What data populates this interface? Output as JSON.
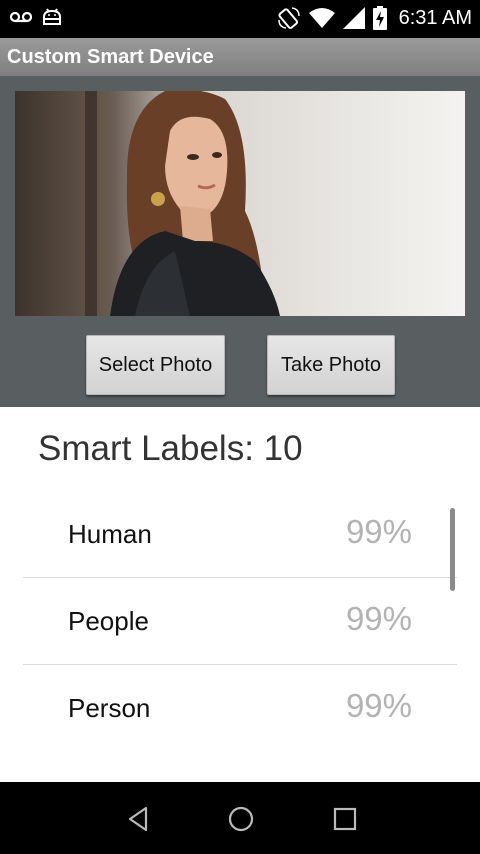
{
  "status_bar": {
    "time": "6:31 AM",
    "icons": [
      "voicemail-icon",
      "android-icon",
      "rotate-icon",
      "wifi-icon",
      "signal-icon",
      "battery-charging-icon"
    ]
  },
  "app": {
    "title": "Custom Smart Device"
  },
  "photo": {
    "description_icon": "portrait-photo"
  },
  "buttons": {
    "select_photo": "Select Photo",
    "take_photo": "Take Photo"
  },
  "labels": {
    "heading": "Smart Labels: 10",
    "items": [
      {
        "name": "Human",
        "percent": "99%"
      },
      {
        "name": "People",
        "percent": "99%"
      },
      {
        "name": "Person",
        "percent": "99%"
      }
    ]
  },
  "nav_bar": {
    "icons": [
      "back-icon",
      "home-icon",
      "recents-icon"
    ]
  },
  "colors": {
    "title_bar": "#8a8a8a",
    "panel": "#595e61",
    "percent_text": "#b3b3b3"
  }
}
